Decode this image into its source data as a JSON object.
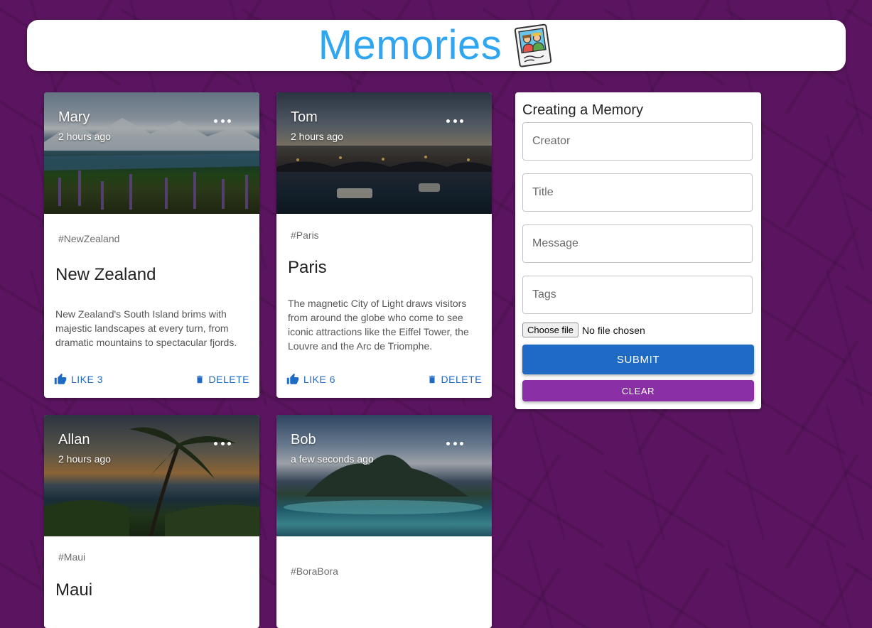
{
  "app": {
    "title": "Memories",
    "logo_icon": "memories-photo-icon"
  },
  "posts": [
    {
      "creator": "Mary",
      "time": "2 hours ago",
      "tags": "#NewZealand",
      "title": "New Zealand",
      "message": "New Zealand's South Island brims with majestic landscapes at every turn, from dramatic mountains to spectacular fjords.",
      "like_label": "LIKE 3",
      "delete_label": "DELETE",
      "image_scene": "mountain-lake-lupins"
    },
    {
      "creator": "Tom",
      "time": "2 hours ago",
      "tags": "#Paris",
      "title": "Paris",
      "message": "The magnetic City of Light draws visitors from around the globe who come to see iconic attractions like the Eiffel Tower, the Louvre and the Arc de Triomphe.",
      "like_label": "LIKE 6",
      "delete_label": "DELETE",
      "image_scene": "river-city-dusk"
    },
    {
      "creator": "Allan",
      "time": "2 hours ago",
      "tags": "#Maui",
      "title": "Maui",
      "image_scene": "palm-coast-sunset"
    },
    {
      "creator": "Bob",
      "time": "a few seconds ago",
      "tags": "#BoraBora",
      "image_scene": "island-lagoon"
    }
  ],
  "form": {
    "heading": "Creating a Memory",
    "creator_placeholder": "Creator",
    "title_placeholder": "Title",
    "message_placeholder": "Message",
    "tags_placeholder": "Tags",
    "choose_file_label": "Choose file",
    "no_file_label": "No file chosen",
    "submit_label": "SUBMIT",
    "clear_label": "CLEAR"
  },
  "colors": {
    "background": "#5b1560",
    "brand": "#2ea6f2",
    "primary": "#1f6ac4",
    "secondary": "#8a2fa5"
  }
}
